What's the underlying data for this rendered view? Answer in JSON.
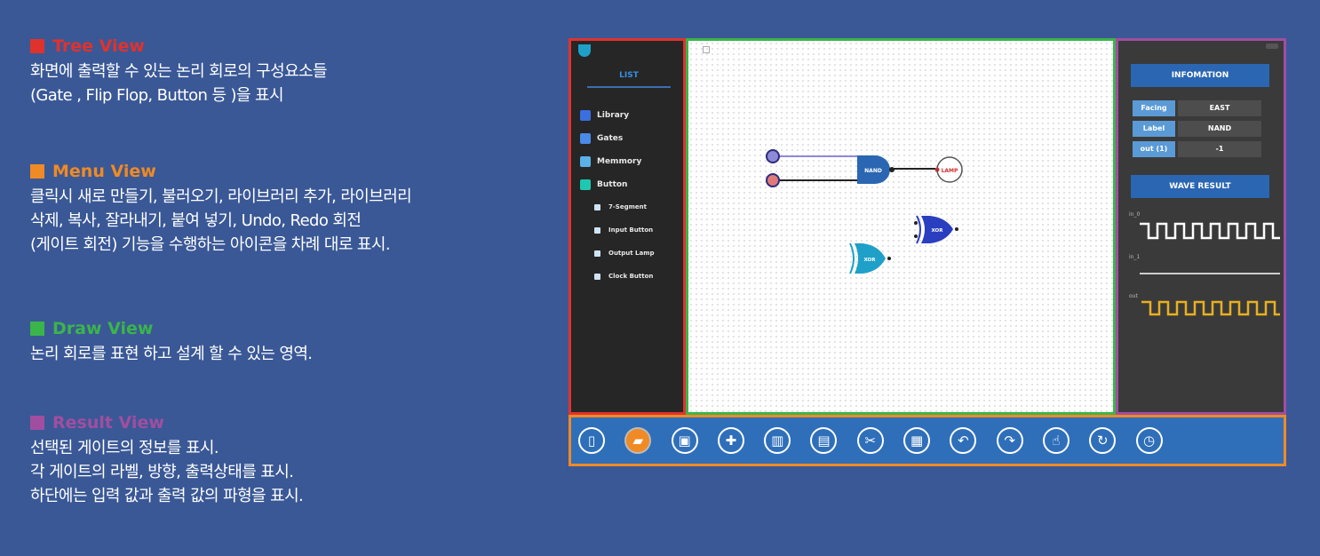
{
  "sections": [
    {
      "title": "Tree View",
      "color": "#e0322d",
      "lines": [
        "화면에 출력할 수 있는 논리 회로의 구성요소들",
        "(Gate , Flip Flop, Button 등 )을 표시"
      ]
    },
    {
      "title": "Menu View",
      "color": "#f08a24",
      "lines": [
        "클릭시 새로 만들기, 불러오기, 라이브러리 추가, 라이브러리",
        "삭제, 복사, 잘라내기, 붙여 넣기, Undo, Redo 회전",
        "(게이트 회전) 기능을 수행하는 아이콘을 차례 대로 표시."
      ]
    },
    {
      "title": "Draw View",
      "color": "#3ab54a",
      "lines": [
        "논리 회로를 표현 하고 설계 할 수 있는 영역."
      ]
    },
    {
      "title": "Result View",
      "color": "#a14ea0",
      "lines": [
        "선택된 게이트의 정보를 표시.",
        "각 게이트의 라벨, 방향, 출력상태를 표시.",
        "하단에는 입력 값과 출력 값의 파형을 표시."
      ]
    }
  ],
  "tree": {
    "list_label": "LIST",
    "items": [
      {
        "label": "Library",
        "color": "#3a6fe0"
      },
      {
        "label": "Gates",
        "color": "#4a8ae8"
      },
      {
        "label": "Memmory",
        "color": "#5ab0e8"
      },
      {
        "label": "Button",
        "color": "#1ec8b0"
      }
    ],
    "subitems": [
      "7-Segment",
      "Input Button",
      "Output Lamp",
      "Clock Button"
    ]
  },
  "draw": {
    "gates": {
      "nand": "NAND",
      "lamp": "LAMP",
      "xor_upper": "XOR",
      "xor_lower": "XOR"
    }
  },
  "result": {
    "info_title": "INFOMATION",
    "properties": [
      {
        "key": "Facing",
        "value": "EAST"
      },
      {
        "key": "Label",
        "value": "NAND"
      },
      {
        "key": "out (1)",
        "value": "-1"
      }
    ],
    "wave_button": "WAVE RESULT",
    "wave_labels": [
      "in_0",
      "in_1",
      "out"
    ],
    "wave_colors": [
      "#ffffff",
      "#cccccc",
      "#e8b020"
    ]
  },
  "menu": {
    "icons": [
      {
        "name": "new-file-icon",
        "glyph": "▯",
        "active": false
      },
      {
        "name": "open-folder-icon",
        "glyph": "▰",
        "active": true
      },
      {
        "name": "save-icon",
        "glyph": "▣",
        "active": false
      },
      {
        "name": "add-library-icon",
        "glyph": "✚",
        "active": false
      },
      {
        "name": "delete-library-icon",
        "glyph": "▥",
        "active": false
      },
      {
        "name": "copy-icon",
        "glyph": "▤",
        "active": false
      },
      {
        "name": "cut-icon",
        "glyph": "✂",
        "active": false
      },
      {
        "name": "paste-icon",
        "glyph": "▦",
        "active": false
      },
      {
        "name": "undo-icon",
        "glyph": "↶",
        "active": false
      },
      {
        "name": "redo-icon",
        "glyph": "↷",
        "active": false
      },
      {
        "name": "hand-icon",
        "glyph": "☝",
        "active": false
      },
      {
        "name": "rotate-icon",
        "glyph": "↻",
        "active": false
      },
      {
        "name": "timer-icon",
        "glyph": "◷",
        "active": false
      }
    ]
  }
}
